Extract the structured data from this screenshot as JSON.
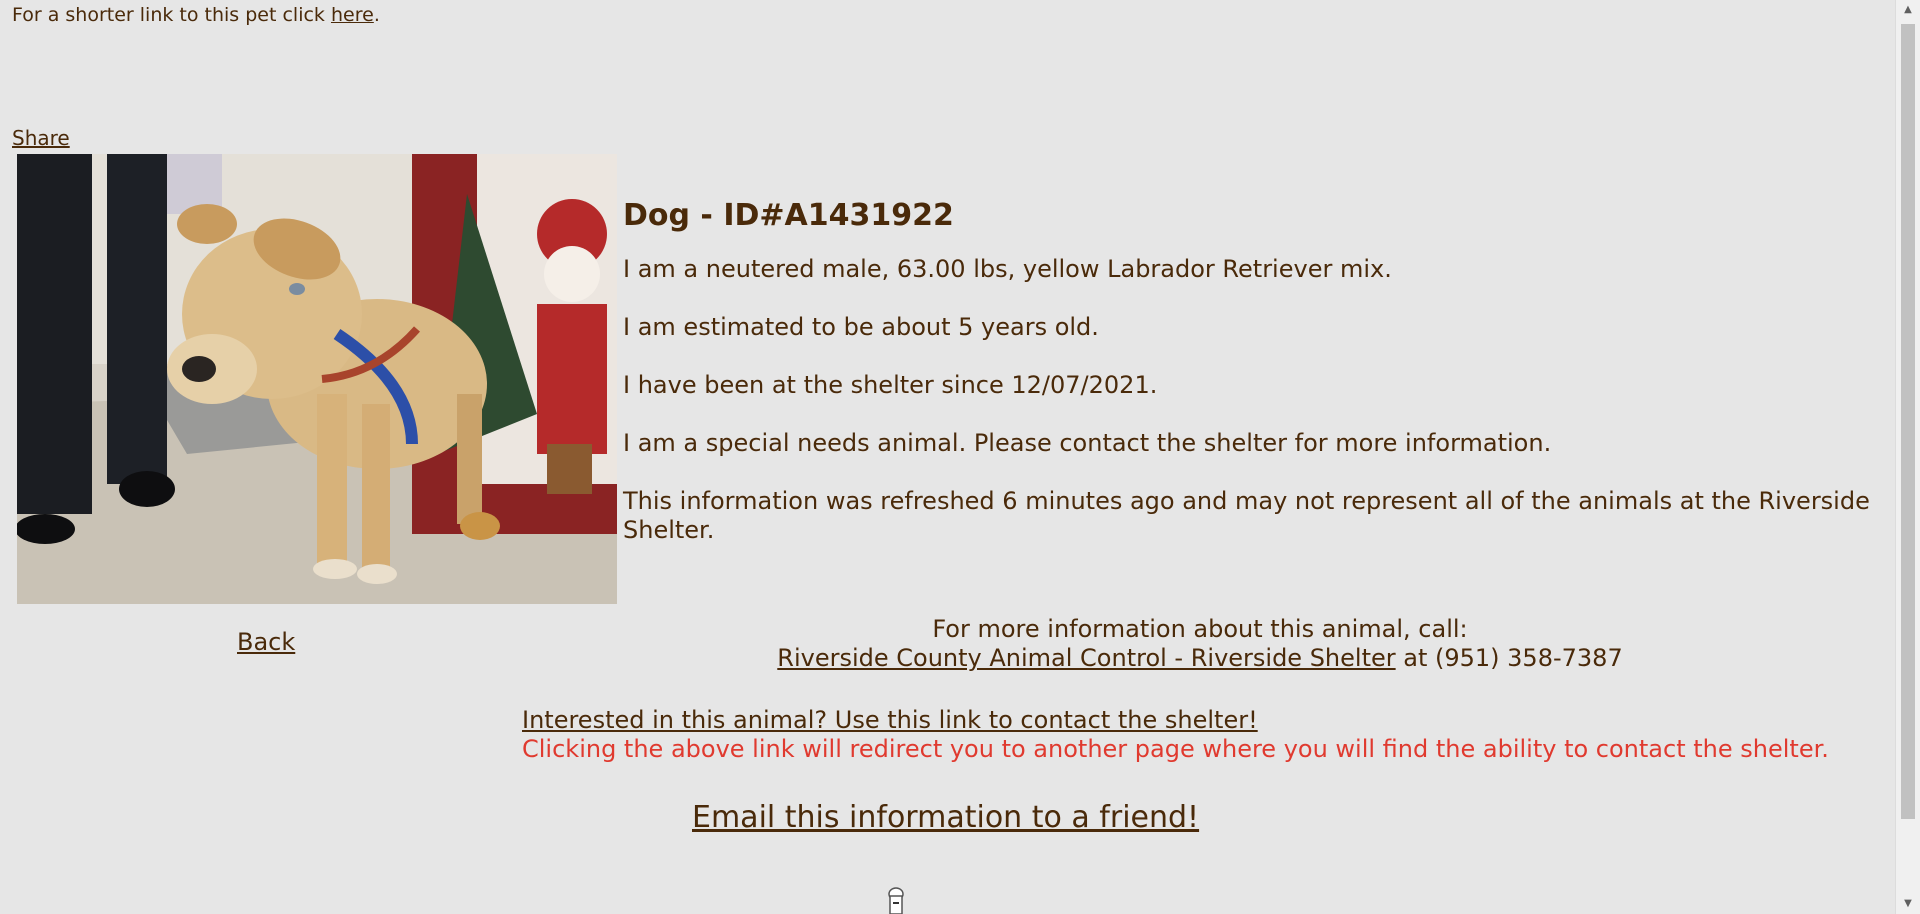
{
  "header": {
    "shorter_link_prefix": "For a shorter link to this pet click ",
    "shorter_link_label": "here",
    "shorter_link_suffix": ".",
    "share_label": "Share"
  },
  "pet": {
    "title": "Dog - ID#A1431922",
    "line1": "I am a neutered male, 63.00 lbs, yellow Labrador Retriever mix.",
    "line2": "I am estimated to be about 5 years old.",
    "line3": "I have been at the shelter since 12/07/2021.",
    "line4": "I am a special needs animal. Please contact the shelter for more information.",
    "line5": "This information was refreshed 6 minutes ago and may not represent all of the animals at the Riverside Shelter."
  },
  "navigation": {
    "back_label": "Back"
  },
  "contact": {
    "intro": "For more information about this animal, call:",
    "shelter_name": "Riverside County Animal Control - Riverside Shelter",
    "phone_text": " at (951) 358-7387",
    "interest_link": "Interested in this animal? Use this link to contact the shelter!",
    "redirect_warning": "Clicking the above link will redirect you to another page where you will find the ability to contact the shelter.",
    "email_link": "Email this information to a friend!"
  },
  "colors": {
    "background": "#e6e6e6",
    "text": "#4a2a0a",
    "warning": "#e03a2f"
  },
  "icons": {
    "scroll_up": "scroll-up-arrow-icon",
    "scroll_down": "scroll-down-arrow-icon",
    "loading": "loading-spinner-icon"
  }
}
